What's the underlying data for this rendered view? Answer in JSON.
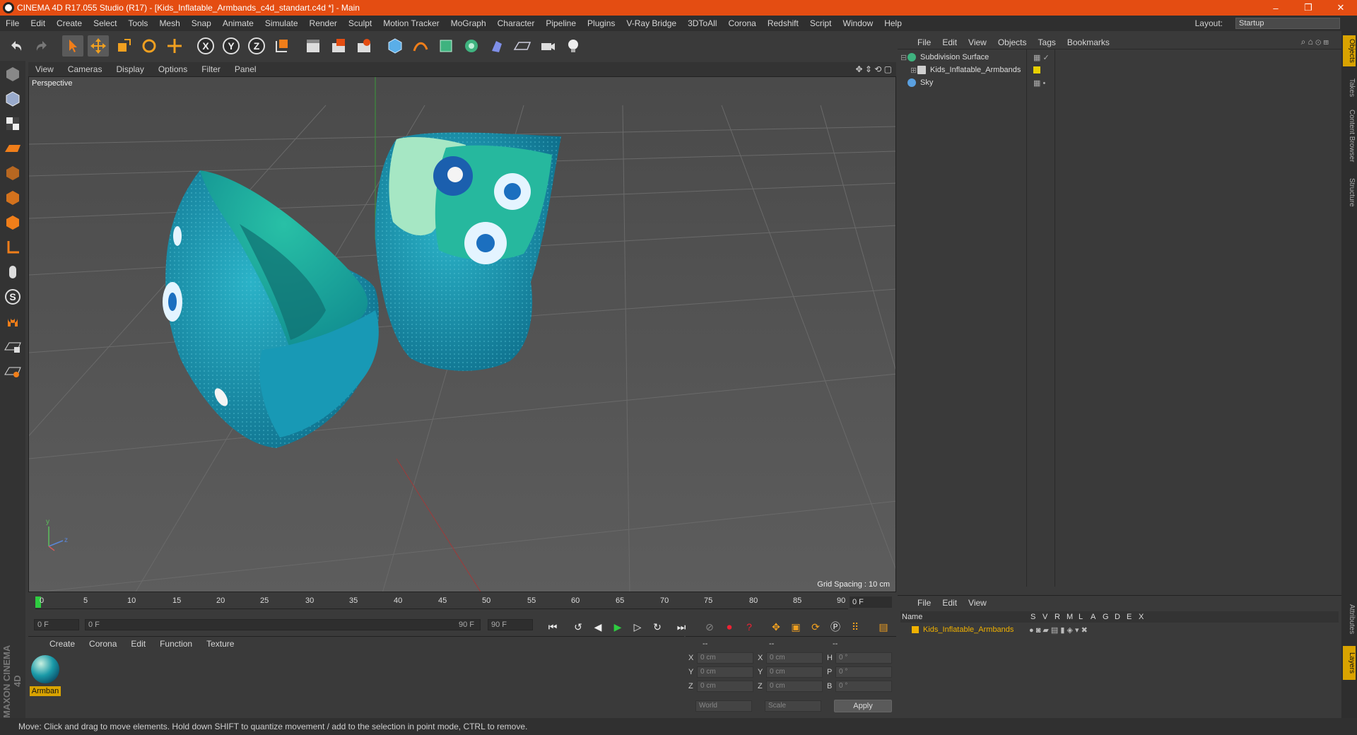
{
  "window": {
    "title": "CINEMA 4D R17.055 Studio (R17) - [Kids_Inflatable_Armbands_c4d_standart.c4d *] - Main",
    "controls": [
      "–",
      "❐",
      "✕"
    ]
  },
  "menubar": {
    "items": [
      "File",
      "Edit",
      "Create",
      "Select",
      "Tools",
      "Mesh",
      "Snap",
      "Animate",
      "Simulate",
      "Render",
      "Sculpt",
      "Motion Tracker",
      "MoGraph",
      "Character",
      "Pipeline",
      "Plugins",
      "V-Ray Bridge",
      "3DToAll",
      "Corona",
      "Redshift",
      "Script",
      "Window",
      "Help"
    ],
    "layout_label": "Layout:",
    "layout_value": "Startup"
  },
  "toolbar": {
    "axis_x": "X",
    "axis_y": "Y",
    "axis_z": "Z"
  },
  "viewport": {
    "menu": [
      "View",
      "Cameras",
      "Display",
      "Options",
      "Filter",
      "Panel"
    ],
    "label": "Perspective",
    "grid_spacing": "Grid Spacing : 10 cm",
    "axis_y": "y",
    "axis_z": "z"
  },
  "timeline": {
    "ticks": [
      "0",
      "5",
      "10",
      "15",
      "20",
      "25",
      "30",
      "35",
      "40",
      "45",
      "50",
      "55",
      "60",
      "65",
      "70",
      "75",
      "80",
      "85",
      "90"
    ],
    "current": "0 F",
    "start_field": "0 F",
    "range_start": "0 F",
    "range_end": "90 F",
    "end_field": "90 F"
  },
  "material_panel": {
    "menu": [
      "Create",
      "Corona",
      "Edit",
      "Function",
      "Texture"
    ],
    "material_name": "Armban"
  },
  "coord_panel": {
    "header": [
      "--",
      "--",
      "--"
    ],
    "col1_labels": [
      "X",
      "Y",
      "Z"
    ],
    "col1_values": [
      "0 cm",
      "0 cm",
      "0 cm"
    ],
    "col2_labels": [
      "X",
      "Y",
      "Z"
    ],
    "col2_values": [
      "0 cm",
      "0 cm",
      "0 cm"
    ],
    "col3_labels": [
      "H",
      "P",
      "B"
    ],
    "col3_values": [
      "0 °",
      "0 °",
      "0 °"
    ],
    "world_select": "World",
    "scale_select": "Scale",
    "apply": "Apply"
  },
  "object_manager": {
    "menu": [
      "File",
      "Edit",
      "View",
      "Objects",
      "Tags",
      "Bookmarks"
    ],
    "objects": [
      {
        "name": "Subdivision Surface",
        "icon_color": "#3fb37f"
      },
      {
        "name": "Kids_Inflatable_Armbands",
        "icon_color": "#cfcfcf",
        "tag_color": "#e8d000"
      },
      {
        "name": "Sky",
        "icon_color": "#5aa0e0"
      }
    ]
  },
  "layer_manager": {
    "menu": [
      "File",
      "Edit",
      "View"
    ],
    "columns": [
      "Name",
      "S",
      "V",
      "R",
      "M",
      "L",
      "A",
      "G",
      "D",
      "E",
      "X"
    ],
    "layer_name": "Kids_Inflatable_Armbands",
    "layer_color": "#f0b100"
  },
  "right_tabs": [
    "Objects",
    "Takes",
    "Content Browser",
    "Structure",
    "Attributes",
    "Layers"
  ],
  "status": "Move: Click and drag to move elements. Hold down SHIFT to quantize movement / add to the selection in point mode, CTRL to remove.",
  "branding": "MAXON CINEMA 4D",
  "colors": {
    "title_bar": "#e44d12",
    "accent_orange": "#f07e1a",
    "teal_model": "#1598b8"
  }
}
